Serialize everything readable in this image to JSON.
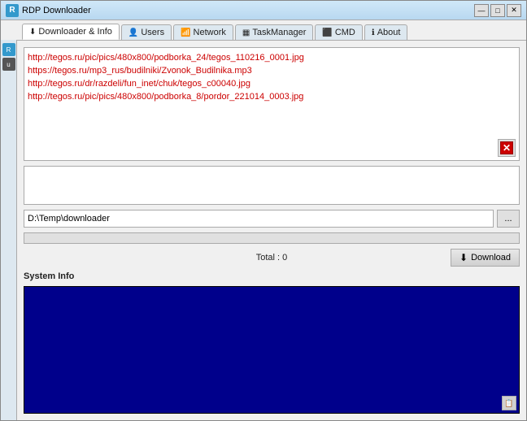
{
  "window": {
    "title": "RDP Downloader",
    "icon": "R",
    "controls": {
      "minimize": "—",
      "maximize": "□",
      "close": "✕"
    }
  },
  "tabs": [
    {
      "id": "downloader",
      "label": "Downloader & Info",
      "icon": "⬇",
      "active": true
    },
    {
      "id": "users",
      "label": "Users",
      "icon": "👤"
    },
    {
      "id": "network",
      "label": "Network",
      "icon": "📶"
    },
    {
      "id": "taskmanager",
      "label": "TaskManager",
      "icon": "▦"
    },
    {
      "id": "cmd",
      "label": "CMD",
      "icon": "⬛"
    },
    {
      "id": "about",
      "label": "About",
      "icon": "ℹ"
    }
  ],
  "downloader": {
    "urls": [
      "http://tegos.ru/pic/pics/480x800/podborka_24/tegos_110216_0001.jpg",
      "https://tegos.ru/mp3_rus/budilniki/Zvonok_Budilnika.mp3",
      "http://tegos.ru/dr/razdeli/fun_inet/chuk/tegos_c00040.jpg",
      "http://tegos.ru/pic/pics/480x800/podborka_8/pordor_221014_0003.jpg"
    ],
    "delete_button_label": "✕",
    "url_input_placeholder": "",
    "path": "D:\\Temp\\downloader",
    "browse_button_label": "...",
    "progress": 0,
    "total_label": "Total : 0",
    "download_button_label": "Download",
    "system_info_label": "System Info",
    "copy_button_label": "📋"
  }
}
